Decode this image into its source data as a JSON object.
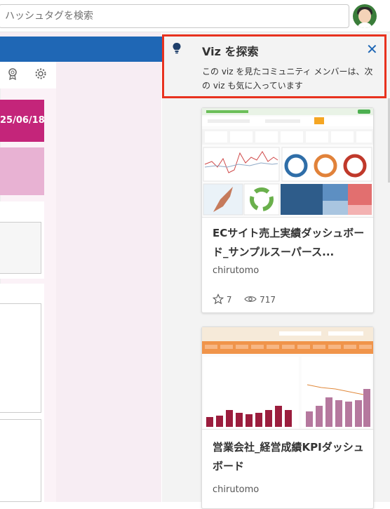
{
  "search": {
    "placeholder": "ハッシュタグを検索"
  },
  "left": {
    "date_label": "25/06/18",
    "tool_icons": [
      "award-icon",
      "gear-icon"
    ]
  },
  "explore_panel": {
    "title": "Viz を探索",
    "close_label": "✕",
    "description": "この viz を見たコミュニティ メンバーは、次の viz も気に入っています"
  },
  "cards": [
    {
      "title": "ECサイト売上実績ダッシュボード_サンプルスーパース...",
      "author": "chirutomo",
      "favorites": "7",
      "views": "717"
    },
    {
      "title": "営業会社_経営成績KPIダッシュボード",
      "author": "chirutomo"
    }
  ],
  "colors": {
    "accent_blue": "#1f67b5",
    "highlight_red": "#e8321f",
    "magenta": "#c4257a",
    "pink": "#e8b2d3"
  }
}
